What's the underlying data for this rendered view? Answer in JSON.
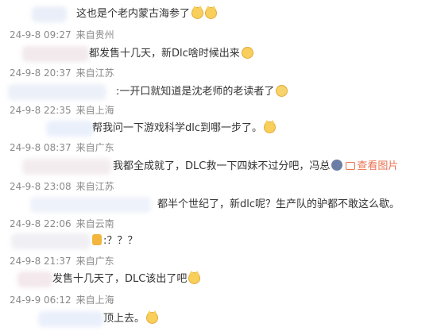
{
  "comments": [
    {
      "text": "这也是个老内蒙古海参了"
    },
    {
      "date": "24-9-8 09:27",
      "loc": "来自贵州",
      "text": "都发售十几天，新Dlc啥时候出来"
    },
    {
      "date": "24-9-8 20:37",
      "loc": "来自江苏",
      "text": ":一开口就知道是沈老师的老读者了"
    },
    {
      "date": "24-9-8 22:35",
      "loc": "来自上海",
      "text": "帮我问一下游戏科学dlc到哪一步了。"
    },
    {
      "date": "24-9-8 08:37",
      "loc": "来自广东",
      "text": "我都全成就了，DLC救一下四妹不过分吧，冯总",
      "link": "查看图片"
    },
    {
      "date": "24-9-8 23:08",
      "loc": "来自江苏",
      "text": "都半个世纪了，新dlc呢？生产队的驴都不敢这么歇。"
    },
    {
      "date": "24-9-8 22:06",
      "loc": "来自云南",
      "text": ":？？？"
    },
    {
      "date": "24-9-8 21:37",
      "loc": "来自广东",
      "text": "发售十几天了，DLC该出了吧"
    },
    {
      "date": "24-9-9 06:12",
      "loc": "来自上海",
      "text": "顶上去。"
    }
  ],
  "colors": {
    "meta": "#8a8a8a",
    "link": "#eb7350",
    "text": "#333333"
  }
}
